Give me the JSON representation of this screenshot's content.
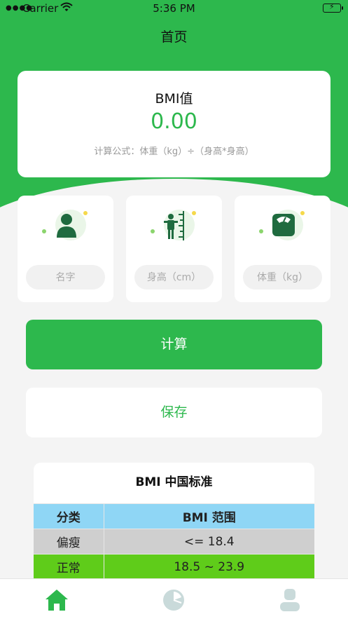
{
  "status_bar": {
    "carrier": "Carrier",
    "time": "5:36 PM"
  },
  "nav": {
    "title": "首页"
  },
  "bmi_card": {
    "label": "BMI值",
    "value": "0.00",
    "formula": "计算公式：体重（kg）÷（身高*身高）"
  },
  "inputs": [
    {
      "icon": "person-icon",
      "placeholder": "名字",
      "value": ""
    },
    {
      "icon": "height-icon",
      "placeholder": "身高（cm）",
      "value": ""
    },
    {
      "icon": "scale-icon",
      "placeholder": "体重（kg）",
      "value": ""
    }
  ],
  "buttons": {
    "calculate": "计算",
    "save": "保存"
  },
  "standard_table": {
    "title": "BMI 中国标准",
    "header": {
      "category": "分类",
      "range": "BMI 范围",
      "color": "#8fd6f5"
    },
    "rows": [
      {
        "category": "偏瘦",
        "range": "<= 18.4",
        "color": "#cfcfcf"
      },
      {
        "category": "正常",
        "range": "18.5 ~ 23.9",
        "color": "#5fcc1a"
      }
    ]
  },
  "tab_bar": [
    {
      "icon": "home-icon",
      "active": true
    },
    {
      "icon": "pie-chart-icon",
      "active": false
    },
    {
      "icon": "user-icon",
      "active": false
    }
  ],
  "colors": {
    "brand": "#2db84d",
    "inactive_icon": "#c9dada"
  }
}
